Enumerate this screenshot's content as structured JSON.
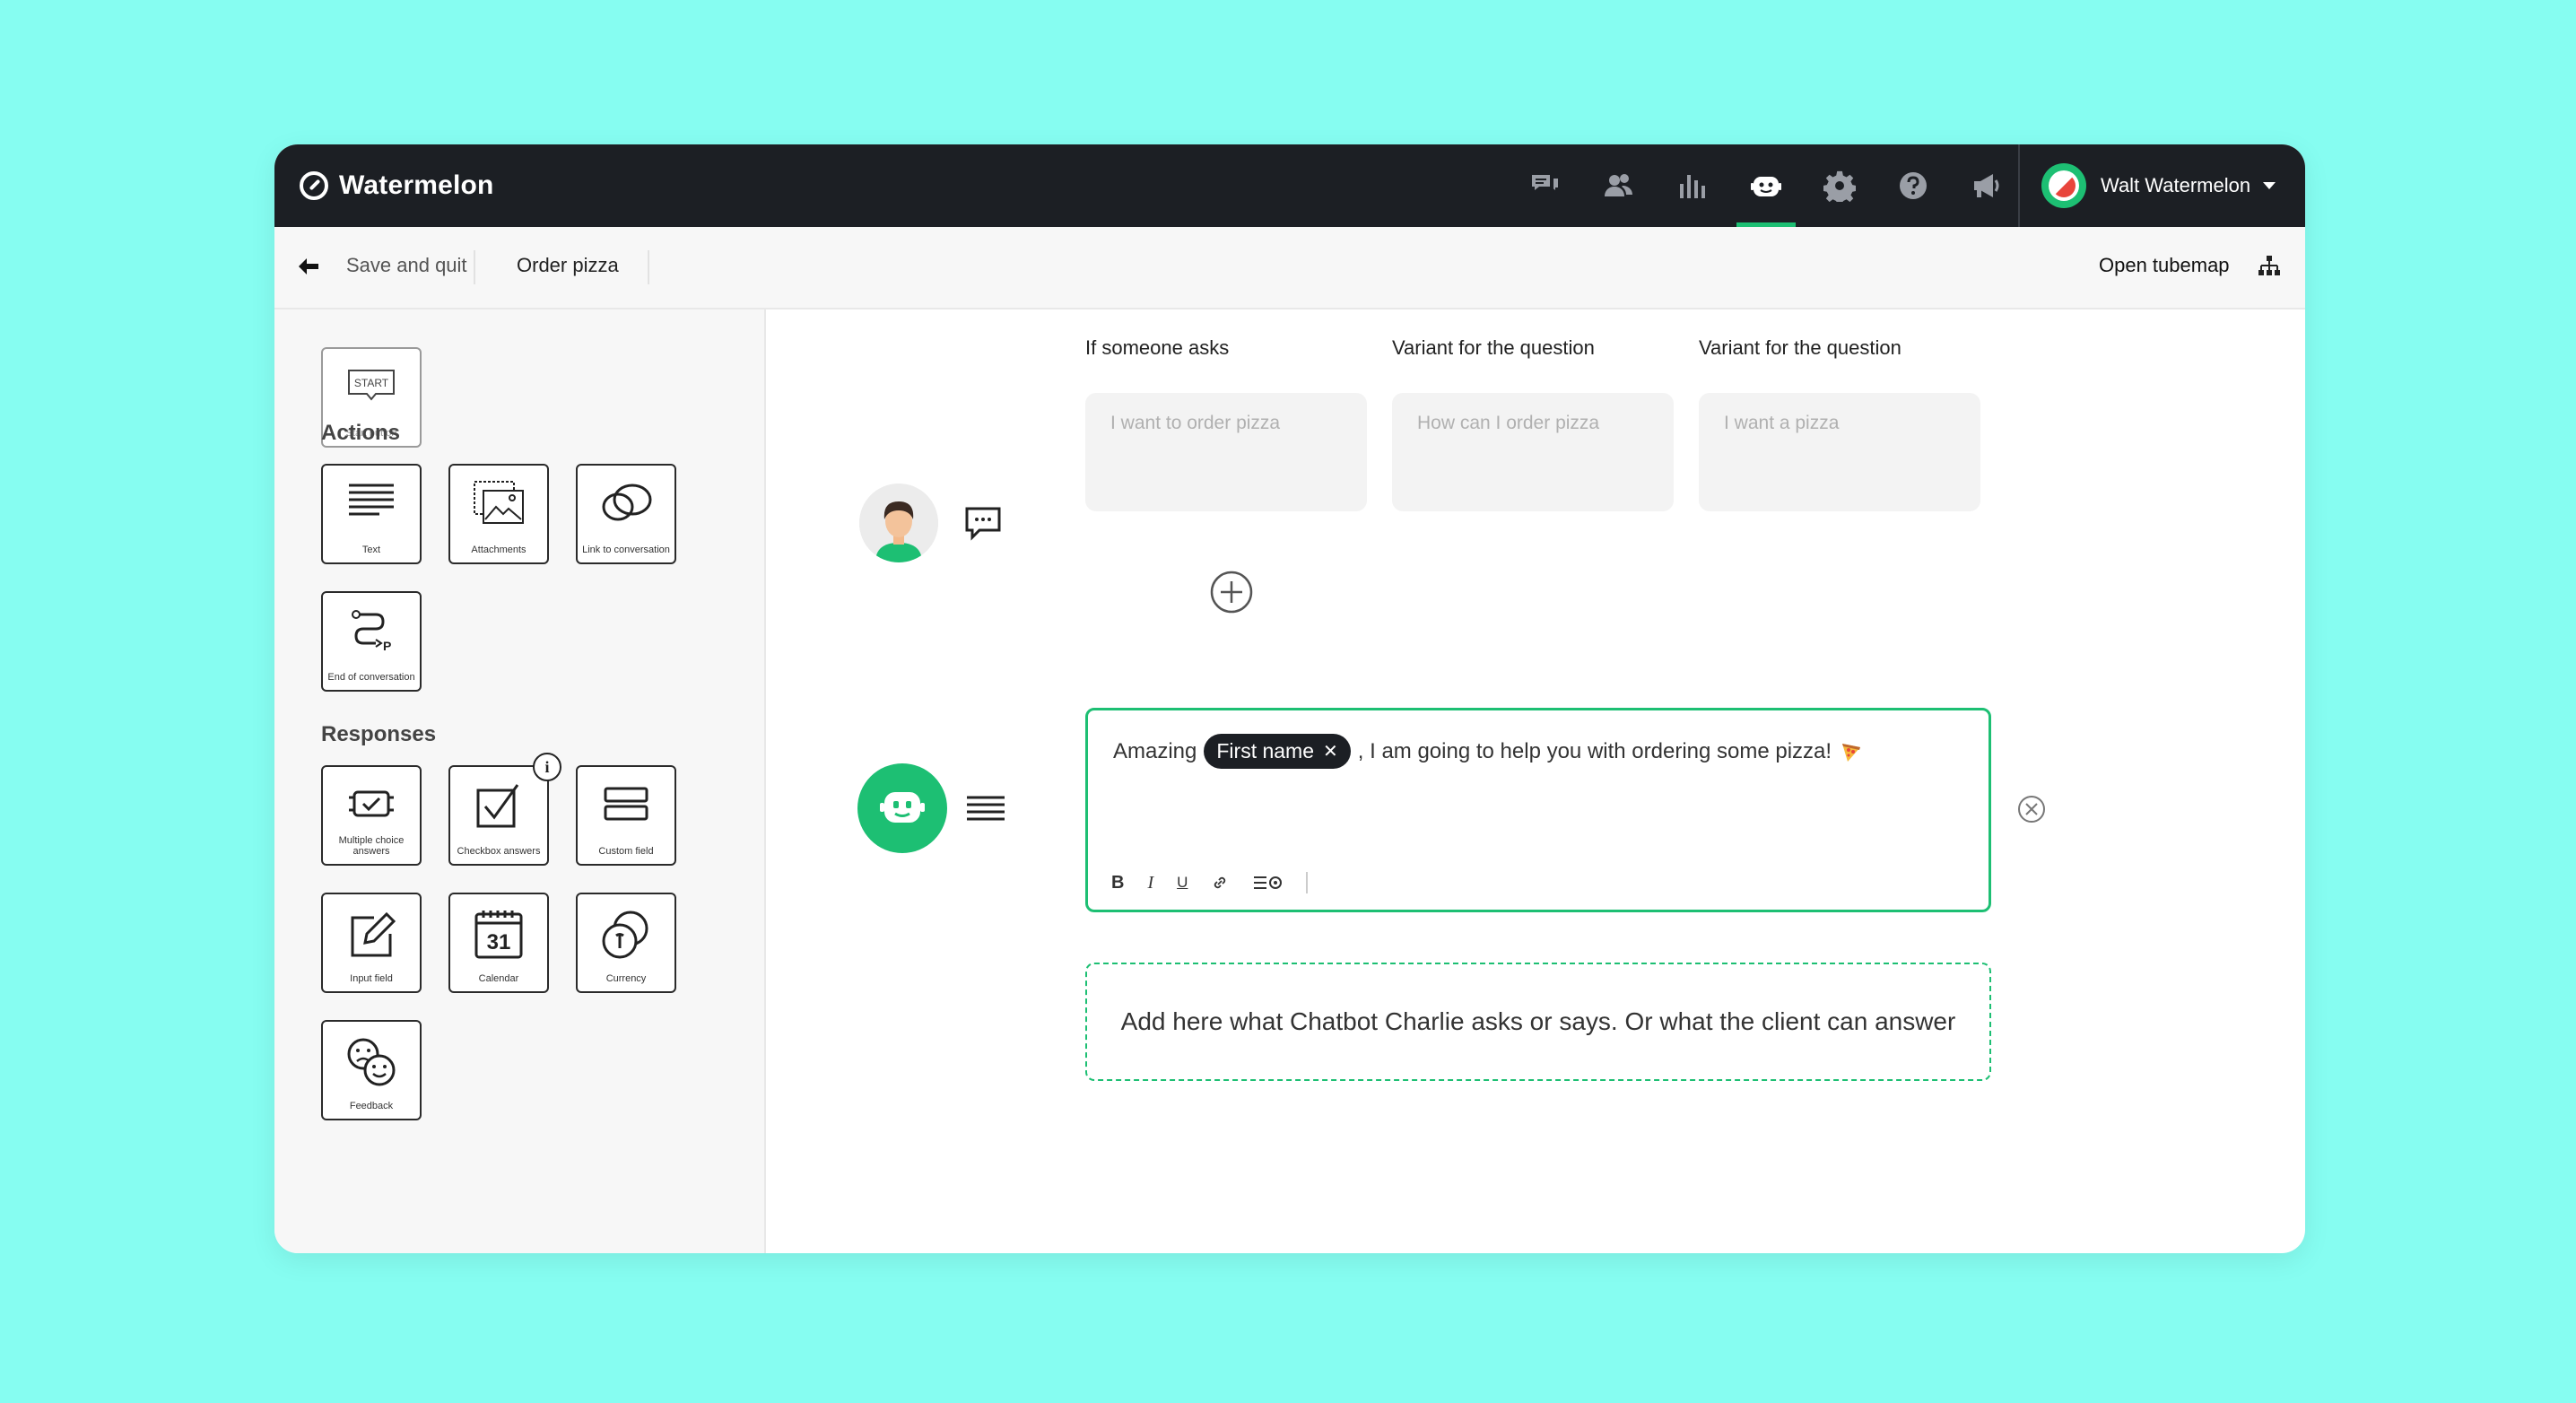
{
  "app": {
    "brand": "Watermelon",
    "user_name": "Walt Watermelon",
    "accent": "#1dbf73",
    "topbar_bg": "#1c1f24",
    "page_bg": "#86fdf1"
  },
  "nav": {
    "items": [
      {
        "icon": "chat-bubbles-icon"
      },
      {
        "icon": "users-icon"
      },
      {
        "icon": "bar-chart-icon"
      },
      {
        "icon": "bot-icon",
        "active": true
      },
      {
        "icon": "gear-icon"
      },
      {
        "icon": "help-icon"
      },
      {
        "icon": "megaphone-icon"
      }
    ]
  },
  "subbar": {
    "save_quit": "Save and quit",
    "flow_name": "Order pizza",
    "open_tubemap": "Open tubemap"
  },
  "sidebar": {
    "start_top": "START",
    "start_label": "Start button",
    "actions_title": "Actions",
    "actions": [
      {
        "label": "Text",
        "icon": "text-lines-icon"
      },
      {
        "label": "Attachments",
        "icon": "attachments-icon"
      },
      {
        "label": "Link to conversation",
        "icon": "link-conversation-icon"
      },
      {
        "label": "End of conversation",
        "icon": "end-conversation-icon"
      }
    ],
    "responses_title": "Responses",
    "info_badge": "i",
    "responses": [
      {
        "label": "Multiple choice answers",
        "icon": "multiple-choice-icon"
      },
      {
        "label": "Checkbox answers",
        "icon": "checkbox-icon"
      },
      {
        "label": "Custom field",
        "icon": "custom-field-icon"
      },
      {
        "label": "Input field",
        "icon": "input-field-icon"
      },
      {
        "label": "Calendar",
        "icon": "calendar-icon"
      },
      {
        "label": "Currency",
        "icon": "currency-icon"
      },
      {
        "label": "Feedback",
        "icon": "feedback-icon"
      }
    ],
    "calendar_day": "31"
  },
  "main": {
    "col1_label": "If someone asks",
    "col2_label": "Variant for the question",
    "col3_label": "Variant for the question",
    "variants": [
      {
        "placeholder": "I want to order pizza"
      },
      {
        "placeholder": "How can I order pizza"
      },
      {
        "placeholder": "I want a pizza"
      }
    ],
    "editor": {
      "prefix": "Amazing",
      "chip": "First name",
      "suffix": ", I am going to help you with ordering some pizza!",
      "toolbar": {
        "bold": "B",
        "italic": "I",
        "underline": "U"
      }
    },
    "drop_zone": "Add here what Chatbot Charlie asks or says. Or what the client can answer"
  }
}
